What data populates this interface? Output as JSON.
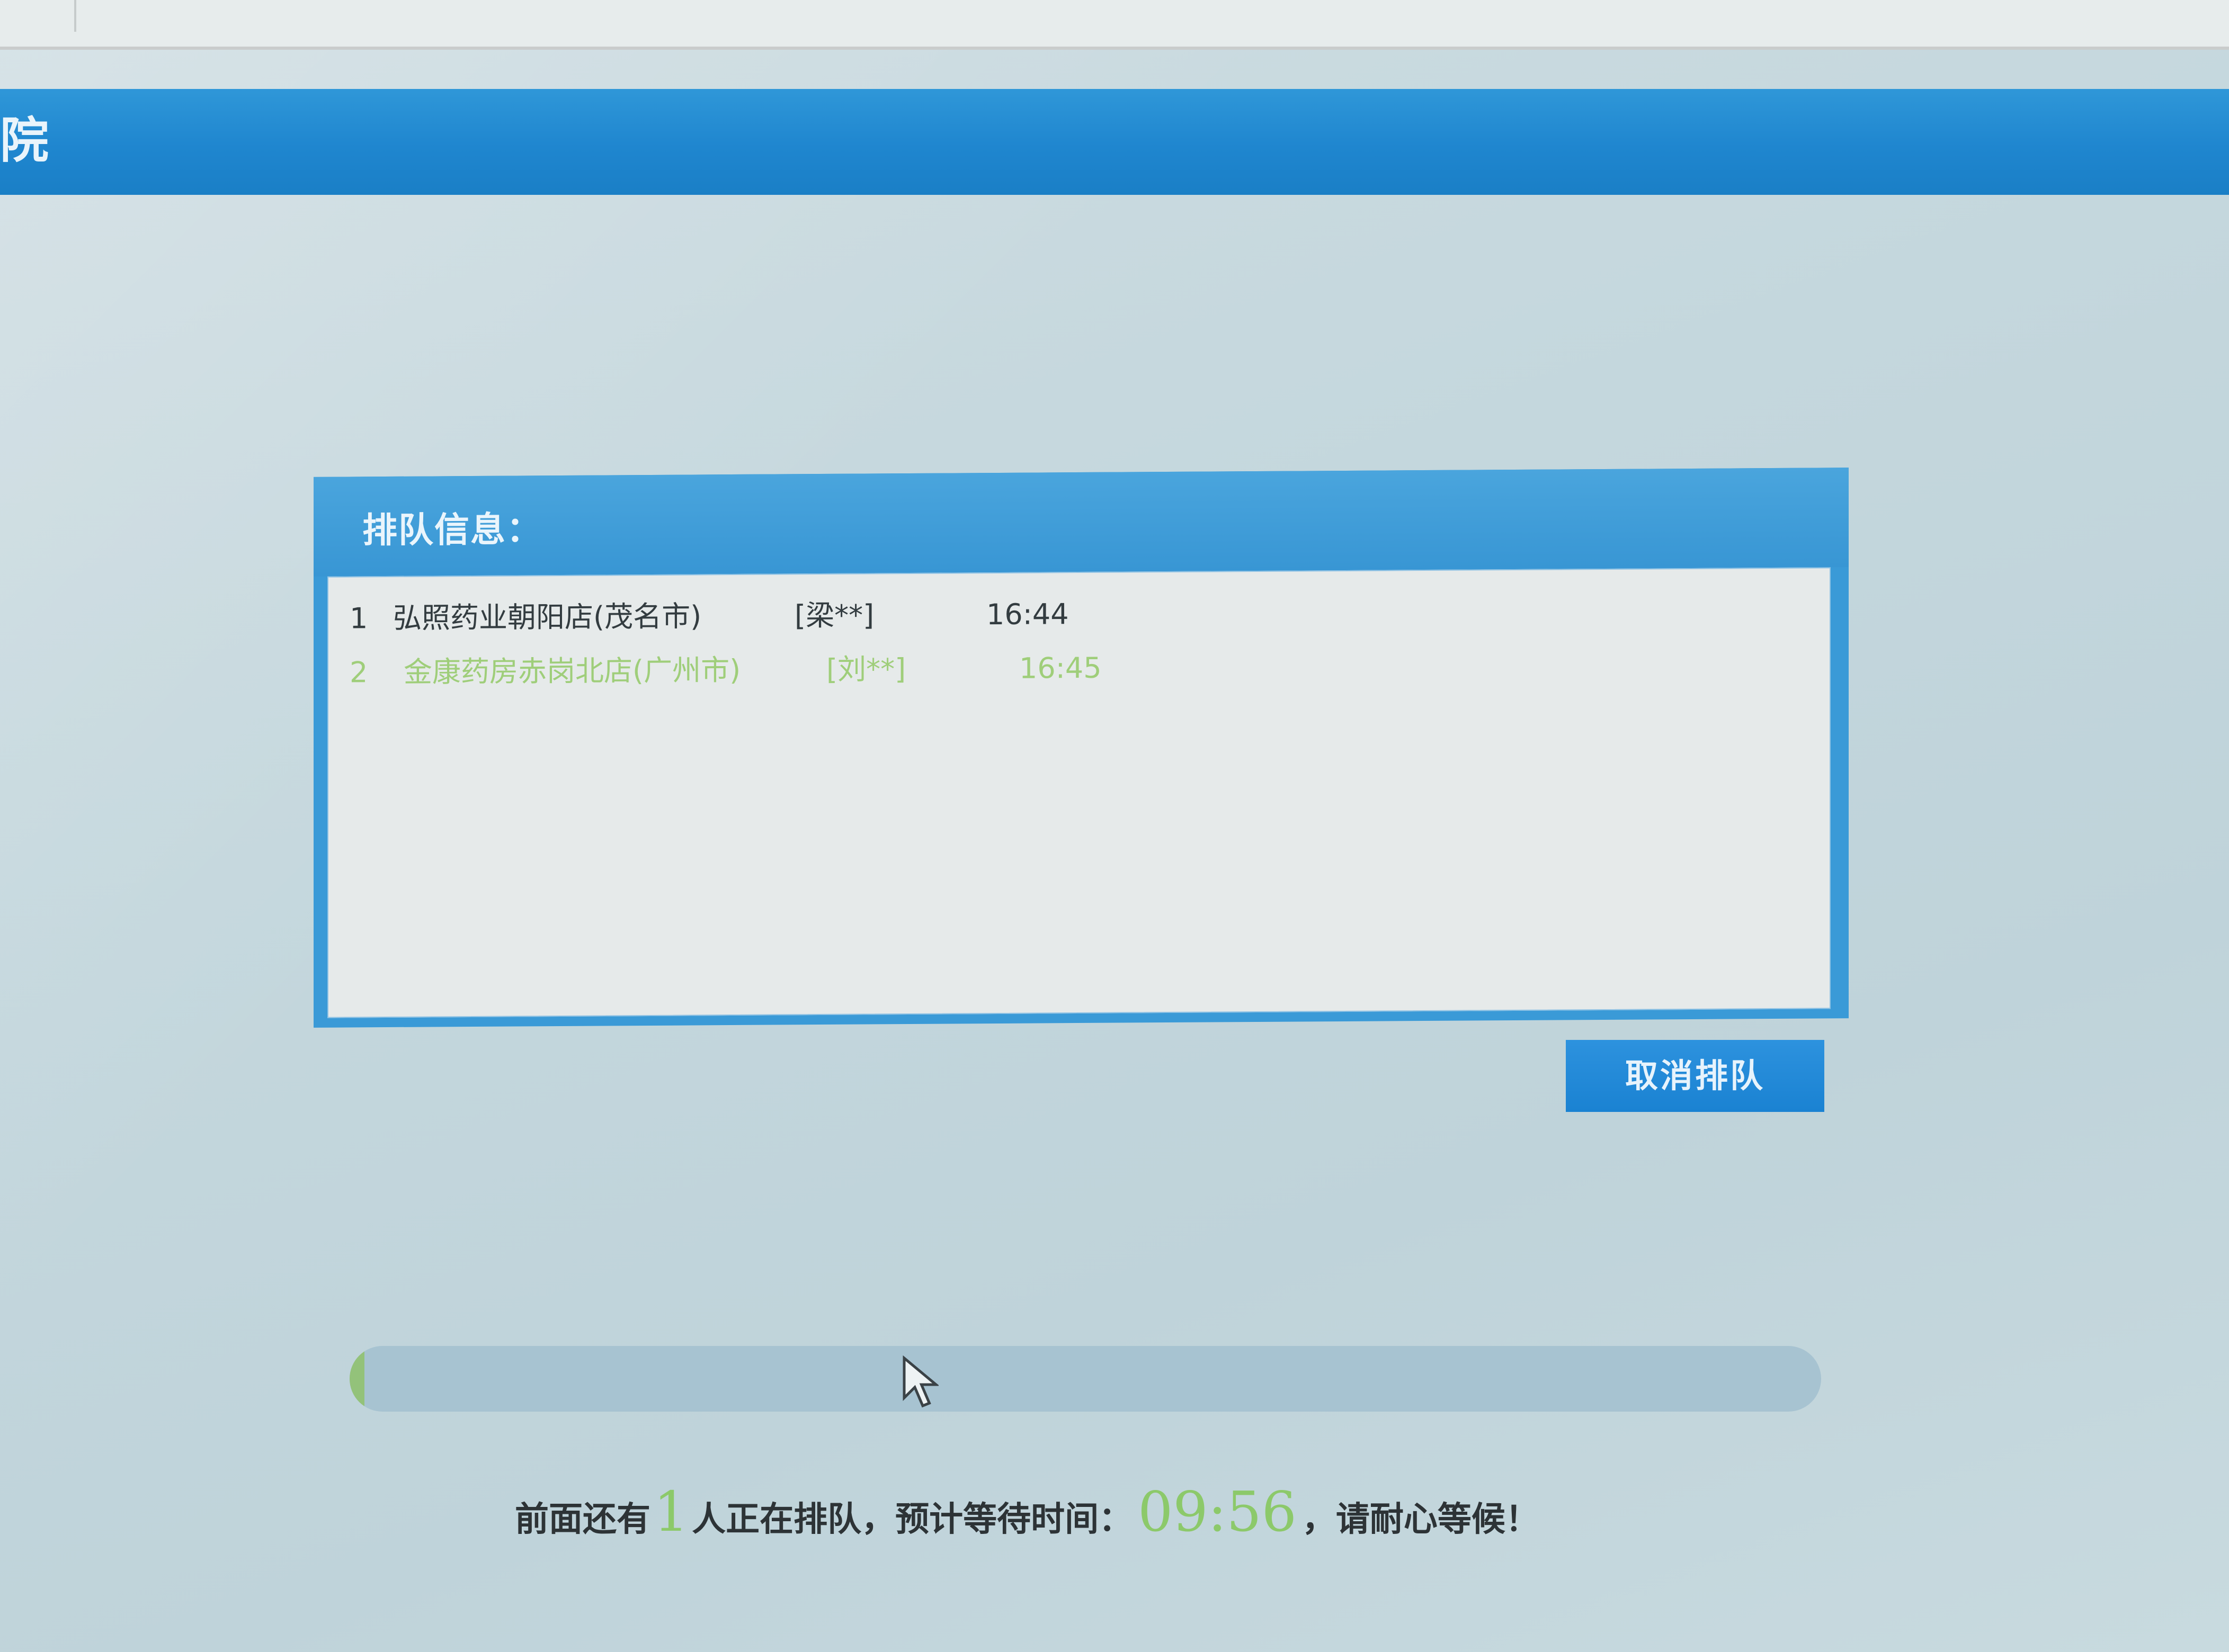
{
  "header": {
    "title": "院"
  },
  "queue_panel": {
    "title": "排队信息：",
    "rows": [
      {
        "index": "1",
        "store": "弘照药业朝阳店(茂名市)",
        "person": "[梁**]",
        "time": "16:44"
      },
      {
        "index": "2",
        "store": "金康药房赤岗北店(广州市)",
        "person": "[刘**]",
        "time": "16:45"
      }
    ]
  },
  "cancel_button": {
    "label": "取消排队"
  },
  "progress": {
    "value": 0.01
  },
  "status": {
    "prefix": "前面还有",
    "count": "1",
    "middle": "人正在排队，预计等待时间：",
    "wait_time": "09:56",
    "suffix": "，请耐心等候！"
  },
  "colors": {
    "header_blue": "#1f86cf",
    "panel_blue": "#3a9ad7",
    "highlight_green": "#8cc96a",
    "background": "#c7d9df"
  }
}
